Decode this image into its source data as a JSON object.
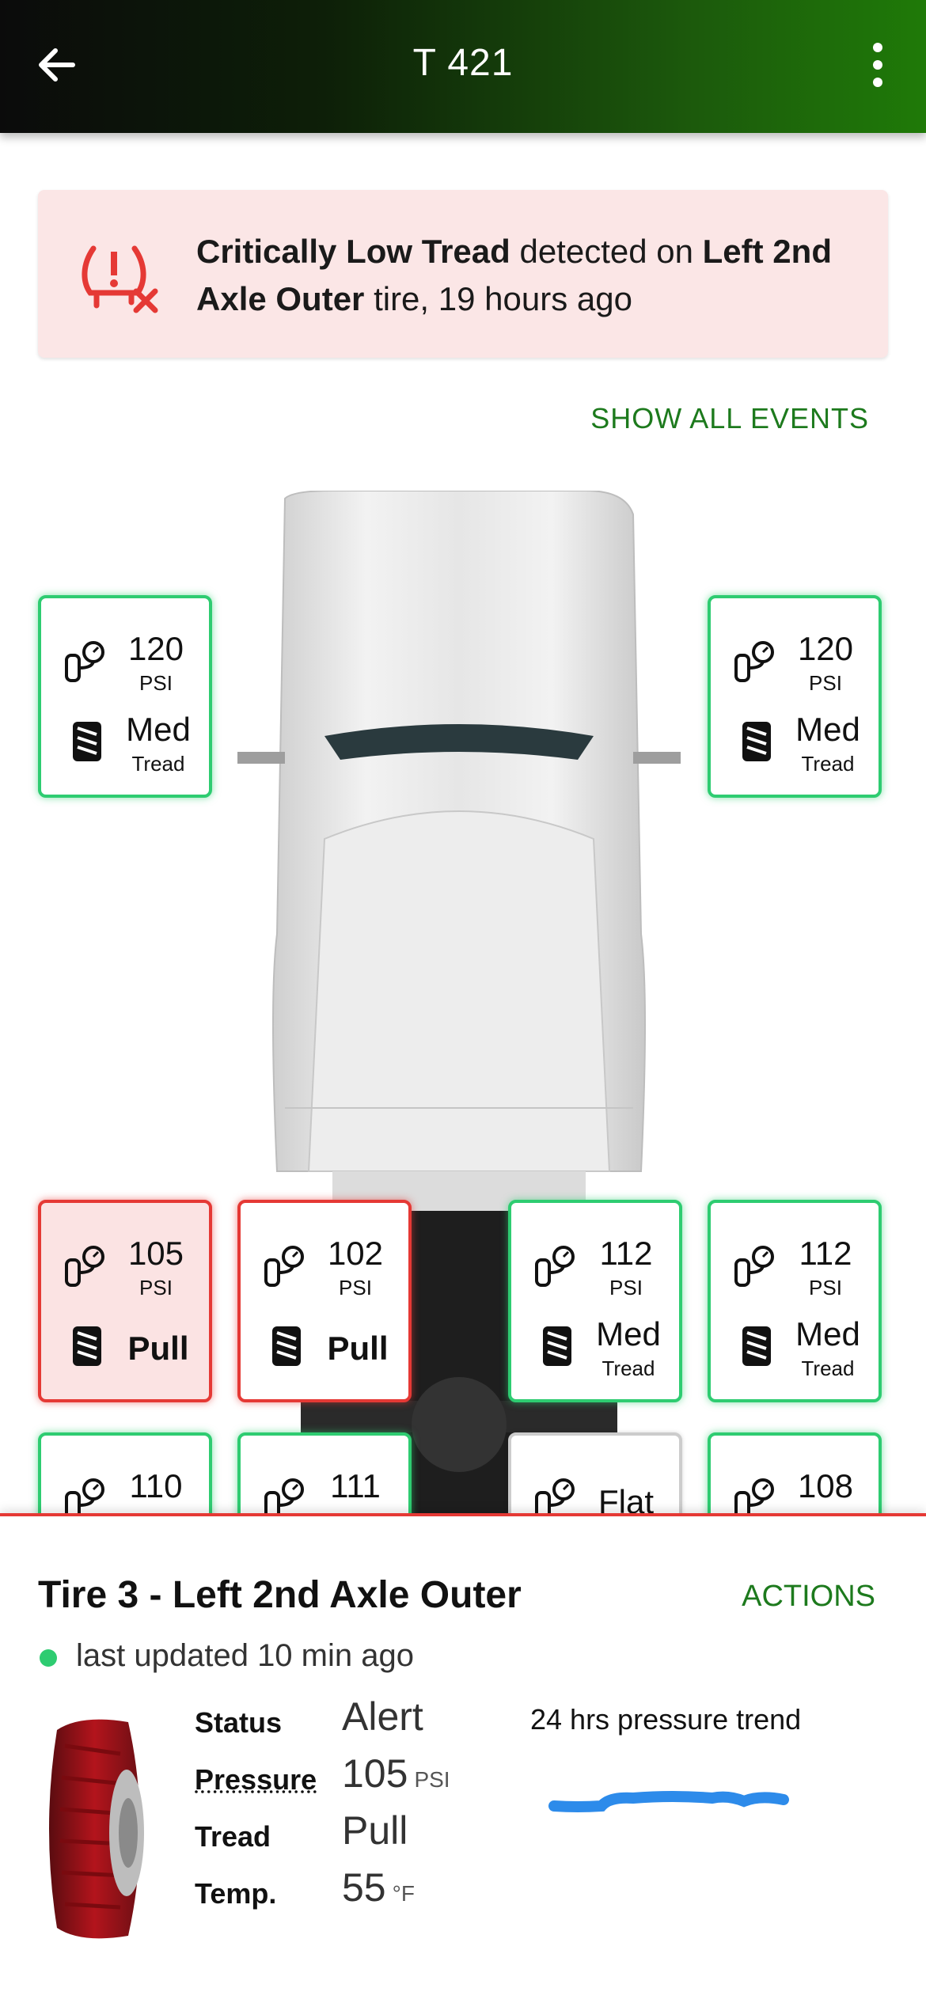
{
  "header": {
    "title": "T 421"
  },
  "alert": {
    "part1": "Critically Low Tread",
    "part2": " detected on ",
    "part3": "Left 2nd Axle Outer",
    "part4": " tire, 19 hours ago"
  },
  "show_all_events": "SHOW ALL EVENTS",
  "tires": [
    {
      "psi": "120",
      "psi_unit": "PSI",
      "tread": "Med",
      "tread_unit": "Tread"
    },
    {
      "psi": "120",
      "psi_unit": "PSI",
      "tread": "Med",
      "tread_unit": "Tread"
    },
    {
      "psi": "105",
      "psi_unit": "PSI",
      "tread": "Pull",
      "tread_unit": ""
    },
    {
      "psi": "102",
      "psi_unit": "PSI",
      "tread": "Pull",
      "tread_unit": ""
    },
    {
      "psi": "112",
      "psi_unit": "PSI",
      "tread": "Med",
      "tread_unit": "Tread"
    },
    {
      "psi": "112",
      "psi_unit": "PSI",
      "tread": "Med",
      "tread_unit": "Tread"
    },
    {
      "psi": "110"
    },
    {
      "psi": "111"
    },
    {
      "psi": "Flat"
    },
    {
      "psi": "108"
    }
  ],
  "detail": {
    "title": "Tire 3 - Left 2nd Axle Outer",
    "actions": "ACTIONS",
    "updated": "last updated 10 min ago",
    "labels": {
      "status": "Status",
      "pressure": "Pressure",
      "tread": "Tread",
      "temp": "Temp."
    },
    "values": {
      "status": "Alert",
      "pressure": "105",
      "pressure_unit": "PSI",
      "tread": "Pull",
      "temp": "55",
      "temp_unit": "°F"
    },
    "trend_title": "24 hrs pressure trend"
  },
  "colors": {
    "ok": "#2ecc71",
    "alert": "#e53935",
    "accent": "#1d7a1d"
  }
}
